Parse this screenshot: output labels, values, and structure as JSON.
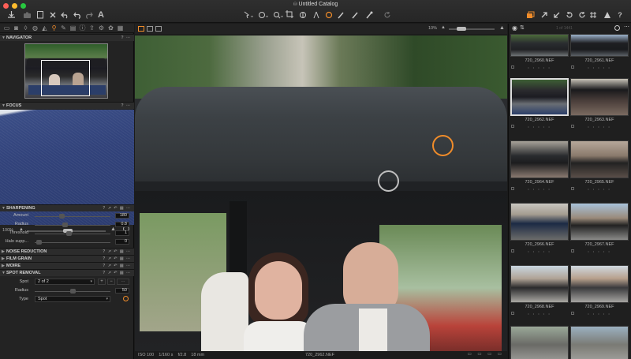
{
  "window": {
    "title": "Untitled Catalog"
  },
  "colors": {
    "accent": "#f08c2a",
    "bg": "#1b1b1b",
    "panel": "#232323"
  },
  "top_toolbar": {
    "left": [
      "import-icon",
      "camera-icon",
      "delete-icon",
      "undo-icon",
      "undo-arrow-icon",
      "redo-icon",
      "text-icon"
    ],
    "center": [
      "cursor-pan-tool",
      "hand-tool",
      "magnify-tool",
      "crop-tool",
      "keystone-tool",
      "straighten-tool",
      "spot-removal-tool",
      "brush-tool",
      "eraser-tool",
      "color-picker-tool",
      "rotate-tool"
    ],
    "right": [
      "copy-adjustments",
      "apply-adjustments",
      "rotate-left",
      "rotate-right",
      "grid-overlay",
      "exposure-warning",
      "help"
    ]
  },
  "left_tabs": [
    "library",
    "capture",
    "lens",
    "color",
    "exposure",
    "details",
    "local",
    "adjust",
    "metadata",
    "output",
    "batch"
  ],
  "navigator": {
    "title": "NAVIGATOR"
  },
  "focus": {
    "title": "FOCUS",
    "zoom": "100%"
  },
  "sharpening": {
    "title": "SHARPENING",
    "rows": [
      {
        "label": "Amount",
        "value": "180",
        "pos": 0.35
      },
      {
        "label": "Radius",
        "value": "0.8",
        "pos": 0.4
      },
      {
        "label": "Threshold",
        "value": "1",
        "pos": 0.45
      },
      {
        "label": "Halo supp...",
        "value": "0",
        "pos": 0.05
      }
    ]
  },
  "collapsed_sections": [
    "NOISE REDUCTION",
    "FILM GRAIN",
    "MOIRE"
  ],
  "spot_removal": {
    "title": "SPOT REMOVAL",
    "spot_label": "Spot",
    "spot_value": "2 of 2",
    "radius_label": "Radius",
    "radius_value": "50",
    "radius_pos": 0.5,
    "type_label": "Type",
    "type_value": "Spot"
  },
  "viewer": {
    "zoom": "10%",
    "footer_left": "ISO 100    1/160 s    f/2.8    18 mm",
    "footer_center": "720_2962.NEF"
  },
  "browser": {
    "count": "1 of 1441",
    "thumbs": [
      {
        "name": "720_2960.NEF"
      },
      {
        "name": "720_2961.NEF"
      },
      {
        "name": "720_2962.NEF",
        "selected": true
      },
      {
        "name": "720_2963.NEF"
      },
      {
        "name": "720_2964.NEF"
      },
      {
        "name": "720_2965.NEF"
      },
      {
        "name": "720_2966.NEF"
      },
      {
        "name": "720_2967.NEF"
      },
      {
        "name": "720_2968.NEF"
      },
      {
        "name": "720_2969.NEF"
      },
      {
        "name": ""
      },
      {
        "name": ""
      }
    ],
    "stars": "• • • • •"
  }
}
